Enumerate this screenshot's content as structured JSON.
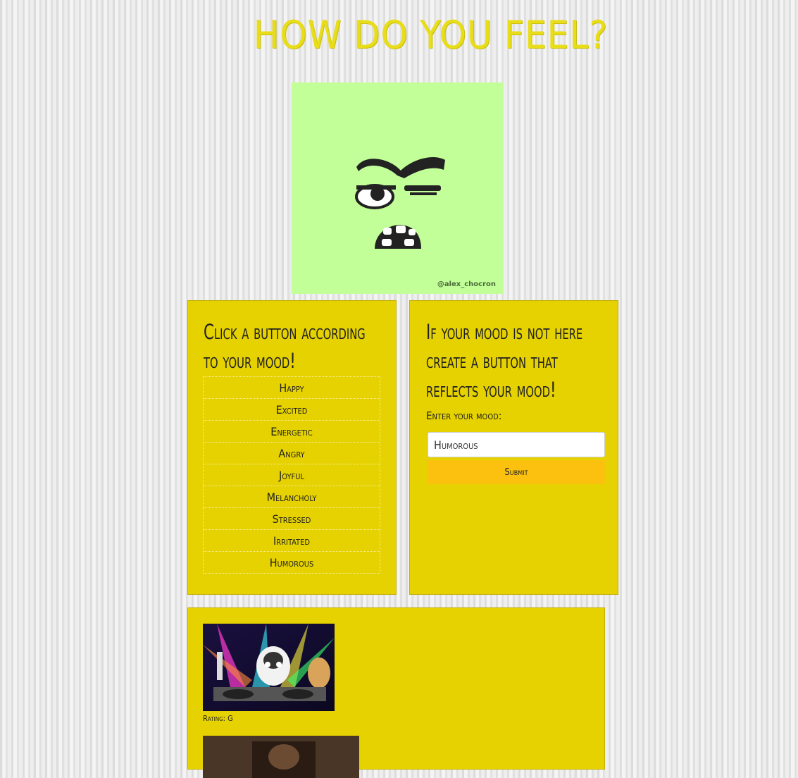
{
  "page": {
    "title": "HOW DO YOU FEEL?",
    "hero_image": {
      "subject": "angry-face-illustration",
      "credit": "@alex_chocron",
      "background": "#c2ff98"
    }
  },
  "colors": {
    "panel": "#e6d200",
    "title": "#e8dd18",
    "submit": "#fcc10f"
  },
  "mood_panel": {
    "heading": "Click a button according to your mood!",
    "moods": [
      "Happy",
      "Excited",
      "Energetic",
      "Angry",
      "Joyful",
      "Melancholy",
      "Stressed",
      "Irritated",
      "Humorous"
    ]
  },
  "create_panel": {
    "heading": "If your mood is not here create a button that reflects your mood!",
    "label": "Enter your mood:",
    "input_value": "Humorous",
    "submit_label": "Submit"
  },
  "results": {
    "items": [
      {
        "subject": "dj-cat-gif",
        "rating_text": "Rating: G"
      },
      {
        "subject": "gif-thumbnail"
      }
    ]
  }
}
